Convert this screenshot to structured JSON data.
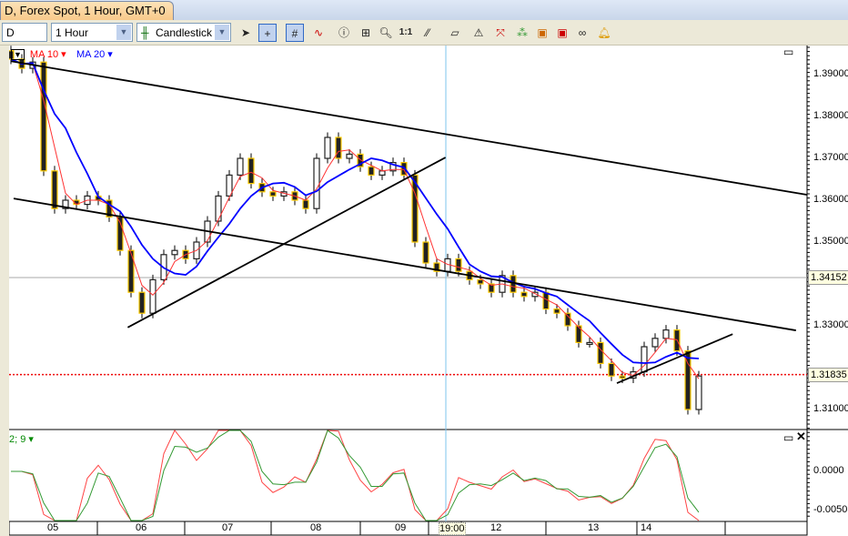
{
  "window": {
    "tab_title": "D, Forex Spot, 1 Hour, GMT+0"
  },
  "toolbar": {
    "symbol": "D",
    "timeframe": "1 Hour",
    "chart_type": "Candlestick",
    "tools": [
      "cursor-icon",
      "crosshair-icon",
      "grid-icon",
      "indicator-icon",
      "info-icon",
      "add-label-icon",
      "zoom-icon",
      "one-to-one-icon",
      "line-tool-icon",
      "eraser-icon",
      "lock-icon",
      "fibonacci-icon",
      "pattern-icon",
      "template-icon",
      "indicator-window-icon",
      "link-icon",
      "alert-bell-icon"
    ],
    "one_to_one": "1:1"
  },
  "legend": {
    "ma10": "MA 10",
    "ma20": "MA 20",
    "osc": "2; 9",
    "ma10_color": "#ff0000",
    "ma20_color": "#0000ff"
  },
  "chart_data": {
    "type": "candlestick",
    "closes": [
      1.3937,
      1.3915,
      1.393,
      1.367,
      1.358,
      1.36,
      1.359,
      1.361,
      1.36,
      1.356,
      1.348,
      1.338,
      1.333,
      1.341,
      1.347,
      1.348,
      1.346,
      1.35,
      1.355,
      1.361,
      1.366,
      1.37,
      1.364,
      1.362,
      1.361,
      1.362,
      1.36,
      1.358,
      1.37,
      1.375,
      1.37,
      1.371,
      1.368,
      1.366,
      1.367,
      1.369,
      1.366,
      1.35,
      1.345,
      1.343,
      1.346,
      1.343,
      1.341,
      1.34,
      1.338,
      1.342,
      1.338,
      1.337,
      1.338,
      1.334,
      1.333,
      1.33,
      1.326,
      1.326,
      1.321,
      1.318,
      1.3175,
      1.319,
      1.325,
      1.327,
      1.329,
      1.324,
      1.31,
      1.318
    ],
    "price_ticks": [
      "1.39000",
      "1.38000",
      "1.37000",
      "1.36000",
      "1.35000",
      "1.33000",
      "1.31000"
    ],
    "price_tick_values": [
      1.39,
      1.38,
      1.37,
      1.36,
      1.35,
      1.33,
      1.31
    ],
    "crosshair_price": "1.34152",
    "current_price": "1.31835",
    "osc_ticks": [
      "0.0000",
      "-0.0050"
    ],
    "time_labels": [
      "05",
      "06",
      "07",
      "08",
      "09",
      "19:00",
      "12",
      "13",
      "14"
    ],
    "trend_lines": [
      [
        [
          0,
          1.3932
        ],
        [
          72.9,
          1.3613
        ]
      ],
      [
        [
          0.25,
          1.3604
        ],
        [
          71.9,
          1.3289
        ]
      ],
      [
        [
          10.7,
          1.3296
        ],
        [
          39.8,
          1.3702
        ]
      ],
      [
        [
          55.5,
          1.3163
        ],
        [
          66.1,
          1.328
        ]
      ]
    ]
  }
}
